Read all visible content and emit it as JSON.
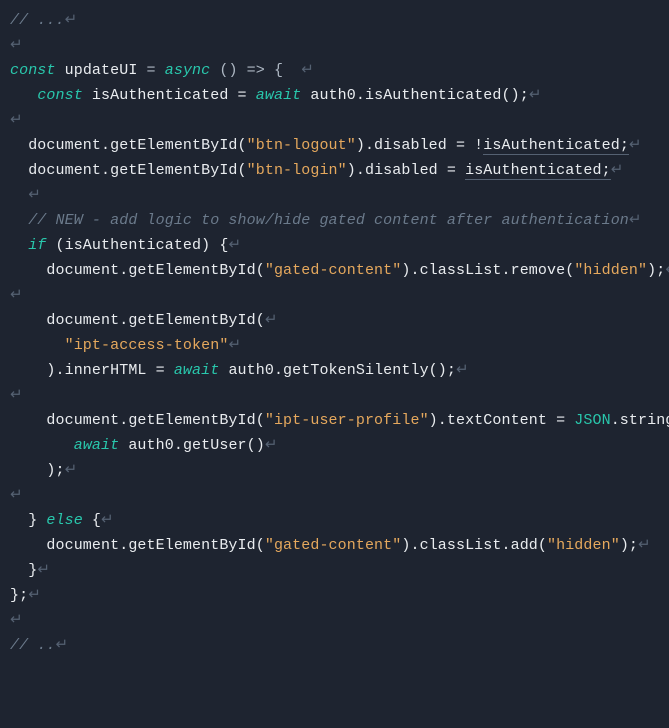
{
  "code": {
    "comment_top": "// ...",
    "kw_const": "const",
    "fn_name": "updateUI",
    "op_eq": " = ",
    "kw_async": "async",
    "arrow": " () => {",
    "line2_a": "const",
    "line2_b": " isAuthenticated = ",
    "line2_c": "await",
    "line2_d": " auth0.isAuthenticated();",
    "line3_a": "document.getElementById(",
    "line3_str": "\"btn-logout\"",
    "line3_b": ").disabled = !",
    "line3_c": "isAuthenticated",
    "semicolon": ";",
    "line4_a": "document.getElementById(",
    "line4_str": "\"btn-login\"",
    "line4_b": ").disabled = ",
    "line4_c": "isAuthenticated",
    "comment_new": "// NEW - add logic to show/hide gated content after authentication",
    "if_a": "if",
    "if_b": " (isAuthenticated) {",
    "gc1_a": "document.getElementById(",
    "gc1_str": "\"gated-content\"",
    "gc1_b": ").classList.remove(",
    "gc1_hidden": "\"hidden\"",
    "gc1_c": ");",
    "tok_a": "document.getElementById(",
    "tok_str": "\"ipt-access-token\"",
    "tok_b": ").innerHTML = ",
    "tok_c": "await",
    "tok_d": " auth0.getTokenSilently();",
    "prof_a": "document.getElementById(",
    "prof_str": "\"ipt-user-profile\"",
    "prof_b": ").textContent = ",
    "prof_json": "JSON",
    "prof_c": ".stringify(",
    "prof_d": "await",
    "prof_e": " auth0.getUser()",
    "prof_f": ");",
    "else_a": "} ",
    "else_kw": "else",
    "else_b": " {",
    "gc2_a": "document.getElementById(",
    "gc2_str": "\"gated-content\"",
    "gc2_b": ").classList.add(",
    "gc2_hidden": "\"hidden\"",
    "gc2_c": ");",
    "close_inner": "}",
    "close_outer": "};",
    "comment_bottom": "// ..",
    "nl": "↵"
  }
}
